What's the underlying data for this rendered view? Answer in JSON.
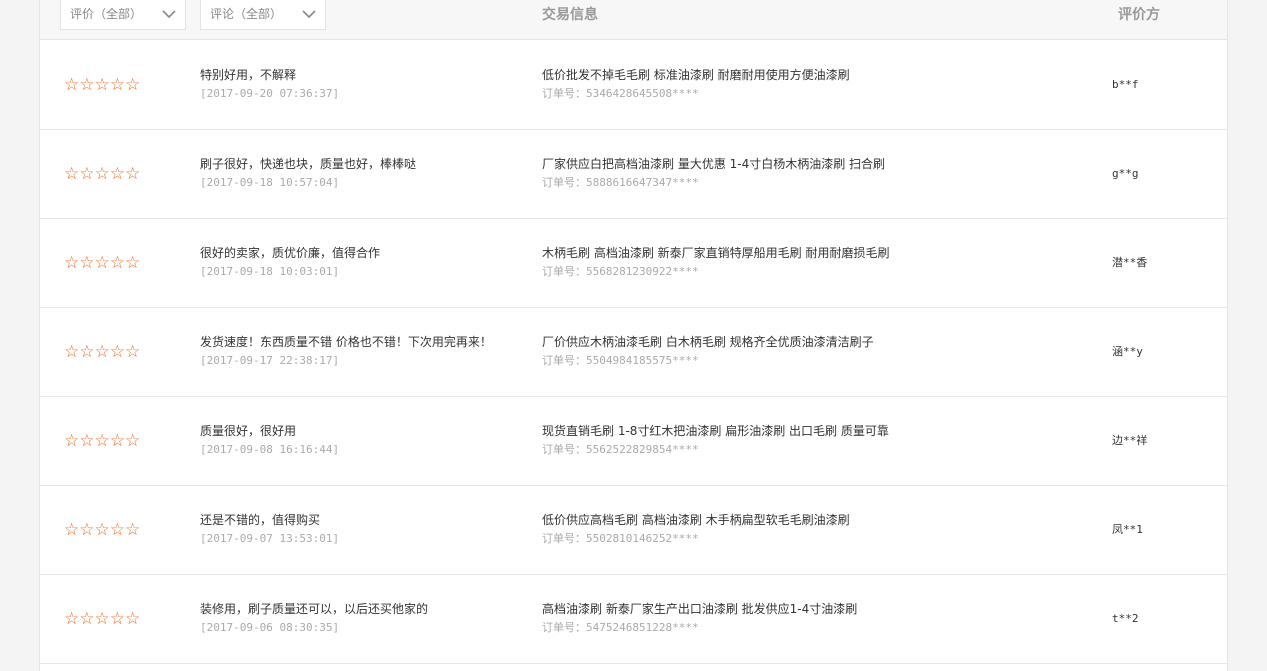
{
  "filters": {
    "rating": "评价（全部）",
    "comment": "评论（全部）"
  },
  "columns": {
    "trade_info": "交易信息",
    "rater": "评价方"
  },
  "order_label": "订单号：",
  "rating_icon": "hollow-star",
  "rating_color": "#f26a21",
  "reviews": [
    {
      "stars": "☆☆☆☆☆",
      "comment": "特别好用，不解释",
      "date": "[2017-09-20 07:36:37]",
      "product": "低价批发不掉毛毛刷 标准油漆刷 耐磨耐用使用方便油漆刷",
      "order": "5346428645508****",
      "rater": "b**f"
    },
    {
      "stars": "☆☆☆☆☆",
      "comment": "刷子很好，快递也块，质量也好，棒棒哒",
      "date": "[2017-09-18 10:57:04]",
      "product": "厂家供应白把高档油漆刷 量大优惠 1-4寸白杨木柄油漆刷 扫合刷",
      "order": "5888616647347****",
      "rater": "g**g"
    },
    {
      "stars": "☆☆☆☆☆",
      "comment": "很好的卖家，质优价廉，值得合作",
      "date": "[2017-09-18 10:03:01]",
      "product": "木柄毛刷 高档油漆刷 新泰厂家直销特厚船用毛刷 耐用耐磨损毛刷",
      "order": "5568281230922****",
      "rater": "潜**香"
    },
    {
      "stars": "☆☆☆☆☆",
      "comment": "发货速度！东西质量不错 价格也不错！下次用完再来！",
      "date": "[2017-09-17 22:38:17]",
      "product": "厂价供应木柄油漆毛刷 白木柄毛刷 规格齐全优质油漆清洁刷子",
      "order": "5504984185575****",
      "rater": "涵**y"
    },
    {
      "stars": "☆☆☆☆☆",
      "comment": "质量很好，很好用",
      "date": "[2017-09-08 16:16:44]",
      "product": "现货直销毛刷 1-8寸红木把油漆刷 扁形油漆刷 出口毛刷 质量可靠",
      "order": "5562522829854****",
      "rater": "边**祥"
    },
    {
      "stars": "☆☆☆☆☆",
      "comment": "还是不错的，值得购买",
      "date": "[2017-09-07 13:53:01]",
      "product": "低价供应高档毛刷 高档油漆刷 木手柄扁型软毛毛刷油漆刷",
      "order": "5502810146252****",
      "rater": "凤**1"
    },
    {
      "stars": "☆☆☆☆☆",
      "comment": "装修用，刷子质量还可以，以后还买他家的",
      "date": "[2017-09-06 08:30:35]",
      "product": "高档油漆刷 新泰厂家生产出口油漆刷 批发供应1-4寸油漆刷",
      "order": "5475246851228****",
      "rater": "t**2"
    }
  ]
}
